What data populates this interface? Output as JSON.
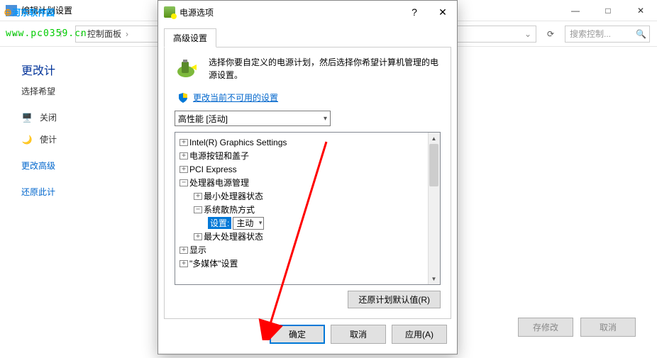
{
  "watermark": {
    "text1": "河东软件园",
    "url": "www.pc0359.cn"
  },
  "parent": {
    "title": "编辑计划设置",
    "breadcrumb_item": "控制面板",
    "search_placeholder": "搜索控制...",
    "heading": "更改计",
    "sub": "选择希望",
    "row_off": "关闭",
    "row_sleep": "使计",
    "link_advanced": "更改高级",
    "link_restore": "还原此计",
    "btn_save": "存修改",
    "btn_cancel": "取消"
  },
  "dialog": {
    "title": "电源选项",
    "tab": "高级设置",
    "description": "选择你要自定义的电源计划，然后选择你希望计算机管理的电源设置。",
    "shield_link": "更改当前不可用的设置",
    "plan_combo": "高性能 [活动]",
    "tree": {
      "n0": "Intel(R) Graphics Settings",
      "n1": "电源按钮和盖子",
      "n2": "PCI Express",
      "n3": "处理器电源管理",
      "n3_0": "最小处理器状态",
      "n3_1": "系统散热方式",
      "n3_1_label": "设置:",
      "n3_1_value": "主动",
      "n3_2": "最大处理器状态",
      "n4": "显示",
      "n5": "\"多媒体\"设置"
    },
    "btn_restore": "还原计划默认值(R)",
    "btn_ok": "确定",
    "btn_cancel": "取消",
    "btn_apply": "应用(A)"
  }
}
